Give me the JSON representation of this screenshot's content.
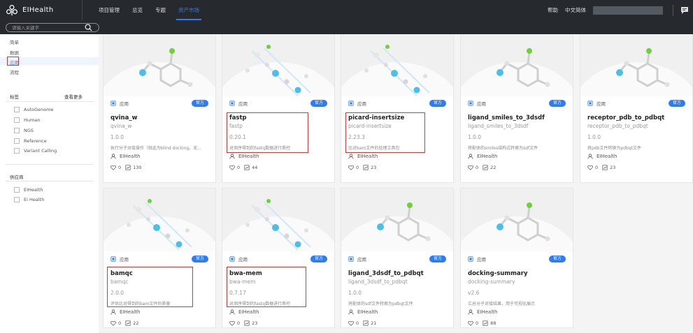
{
  "header": {
    "app_name": "EIHealth",
    "nav": [
      "项目管理",
      "总览",
      "专题",
      "资产市场"
    ],
    "active_nav": 3,
    "help": "帮助",
    "language": "中文简体"
  },
  "search": {
    "placeholder": "请输入关键字"
  },
  "sidebar": {
    "types": [
      "简单",
      "数据",
      "应用",
      "流程"
    ],
    "selected_type": 2,
    "tags_title": "标签",
    "see_more": "查看更多",
    "tags": [
      "AutoGenome",
      "Human",
      "NGS",
      "Reference",
      "Variant Calling"
    ],
    "supplier_title": "供应商",
    "suppliers": [
      "EIHealth",
      "Ei Health"
    ]
  },
  "cards": [
    {
      "type_label": "应用",
      "badge": "官方",
      "title": "qvina_w",
      "subtitle": "qvina_w",
      "version": "1.0.0",
      "desc": "执行分子对接操作（就此为blind docking。无...",
      "owner": "EIHealth",
      "likes": "0",
      "uses": "130",
      "thumb": "mol"
    },
    {
      "type_label": "应用",
      "badge": "官方",
      "title": "fastp",
      "subtitle": "fastp",
      "version": "0.20.1",
      "desc": "对测序得到的fastq数据进行质控",
      "owner": "EIHealth",
      "likes": "0",
      "uses": "44",
      "thumb": "dna"
    },
    {
      "type_label": "应用",
      "badge": "官方",
      "title": "picard-insertsize",
      "subtitle": "picard-insertsize",
      "version": "2.23.3",
      "desc": "比对bam文件的处理工具包",
      "owner": "EIHealth",
      "likes": "0",
      "uses": "23",
      "thumb": "dna"
    },
    {
      "type_label": "应用",
      "badge": "官方",
      "title": "ligand_smiles_to_3dsdf",
      "subtitle": "ligand_smiles_to_3dsdf",
      "version": "1.0.0",
      "desc": "将配体的smiles结构式转换为sdf文件",
      "owner": "EIHealth",
      "likes": "0",
      "uses": "22",
      "thumb": "mol"
    },
    {
      "type_label": "应用",
      "badge": "官方",
      "title": "receptor_pdb_to_pdbqt",
      "subtitle": "receptor_pdb_to_pdbqt",
      "version": "1.0.0",
      "desc": "将pdb文件转换为pdbqt文件",
      "owner": "EIHealth",
      "likes": "0",
      "uses": "23",
      "thumb": "mol"
    },
    {
      "type_label": "应用",
      "badge": "官方",
      "title": "bamqc",
      "subtitle": "bamqc",
      "version": "2.0.0",
      "desc": "评估比对得到的bam文件的质量",
      "owner": "EIHealth",
      "likes": "0",
      "uses": "22",
      "thumb": "dna"
    },
    {
      "type_label": "应用",
      "badge": "官方",
      "title": "bwa-mem",
      "subtitle": "bwa-mem",
      "version": "0.7.17",
      "desc": "对测序得到的fastq数据进行质控",
      "owner": "EIHealth",
      "likes": "0",
      "uses": "23",
      "thumb": "dna"
    },
    {
      "type_label": "应用",
      "badge": "官方",
      "title": "ligand_3dsdf_to_pdbqt",
      "subtitle": "ligand_3dsdf_to_pdbqt",
      "version": "1.0.0",
      "desc": "将配体的sdf文件转换为pdbqt文件",
      "owner": "EIHealth",
      "likes": "0",
      "uses": "21",
      "thumb": "mol"
    },
    {
      "type_label": "应用",
      "badge": "官方",
      "title": "docking-summary",
      "subtitle": "docking-summary",
      "version": "v2.6",
      "desc": "汇总分子对接结果，用于可视化展示",
      "owner": "EIHealth",
      "likes": "0",
      "uses": "88",
      "thumb": "mol"
    }
  ]
}
